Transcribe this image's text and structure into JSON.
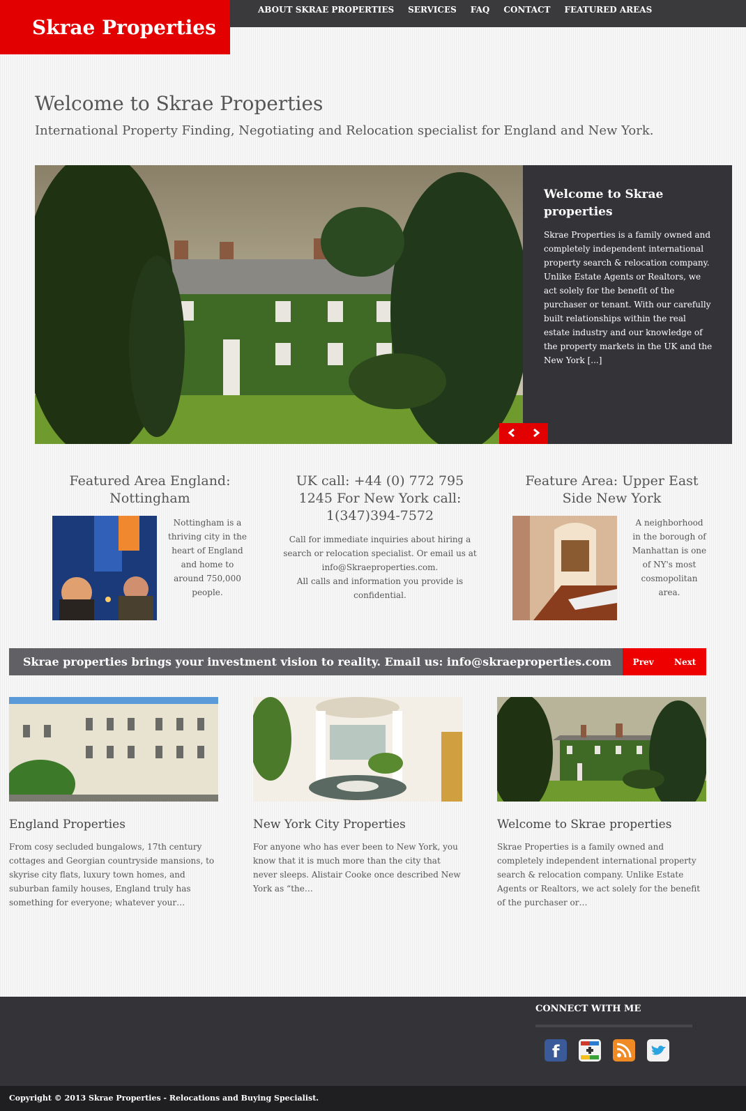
{
  "header": {
    "logo": "Skrae Properties",
    "nav": [
      "ABOUT SKRAE PROPERTIES",
      "SERVICES",
      "FAQ",
      "CONTACT",
      "FEATURED AREAS"
    ]
  },
  "intro": {
    "title": "Welcome to Skrae Properties",
    "subtitle": "International Property Finding, Negotiating and Relocation specialist for England and New York."
  },
  "slider": {
    "caption_title": "Welcome to Skrae properties",
    "caption_text": "Skrae Properties is a family owned and completely independent international property search & relocation company. Unlike Estate Agents or Realtors, we act solely for the benefit of the purchaser or tenant. With our carefully built relationships within the real estate industry and our knowledge of  the property markets in the UK and the New York [...]",
    "prev_icon": "chevron-left-icon",
    "next_icon": "chevron-right-icon"
  },
  "featured": {
    "england": {
      "title": "Featured Area England: Nottingham",
      "text": "Nottingham is a thriving city in the heart of England and home to around 750,000 people."
    },
    "contact": {
      "title": "UK call: +44 (0) 772 795 1245 For New York call: 1(347)394-7572",
      "text": "Call for immediate inquiries about hiring a search or relocation specialist. Or email us at info@Skraeproperties.com.",
      "text2": "All calls and information you provide is confidential."
    },
    "newyork": {
      "title": "Feature Area: Upper East Side New York",
      "text": "A neighborhood in the borough of Manhattan is one of NY's most cosmopolitan area."
    }
  },
  "banner": {
    "text": "Skrae properties brings your investment vision to reality. Email us: info@skraeproperties.com",
    "prev": "Prev",
    "next": "Next"
  },
  "posts": [
    {
      "title": "England Properties",
      "excerpt": "From cosy secluded bungalows, 17th century cottages and Georgian countryside mansions, to skyrise city flats, luxury town homes, and suburban family houses, England truly has something for everyone; whatever your…"
    },
    {
      "title": "New York City Properties",
      "excerpt": "For anyone who has ever been to New York, you know that it is much more than the city that never sleeps. Alistair Cooke once described New York as “the…"
    },
    {
      "title": "Welcome to Skrae properties",
      "excerpt": "Skrae Properties is a family owned and completely independent international property search & relocation company. Unlike Estate Agents or Realtors, we act solely for the benefit of the purchaser or…"
    }
  ],
  "footer": {
    "connect_title": "CONNECT WITH ME",
    "social": [
      "facebook-icon",
      "google-plus-icon",
      "rss-icon",
      "twitter-icon"
    ],
    "copyright": "Copyright © 2013 Skrae Properties - Relocations and Buying Specialist."
  },
  "colors": {
    "brand_red": "#e30000",
    "dark": "#333338"
  }
}
